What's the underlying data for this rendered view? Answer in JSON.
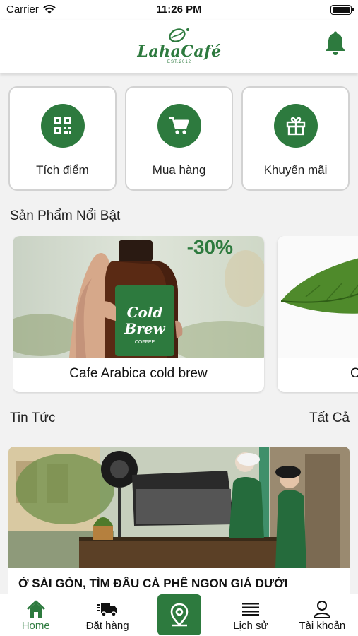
{
  "status_bar": {
    "carrier": "Carrier",
    "time": "11:26 PM"
  },
  "header": {
    "brand": "LahaCafé",
    "est": "EST.2012",
    "bell_icon": "bell-icon"
  },
  "quick_actions": [
    {
      "label": "Tích điểm",
      "icon": "qr-code-icon"
    },
    {
      "label": "Mua hàng",
      "icon": "cart-icon"
    },
    {
      "label": "Khuyến mãi",
      "icon": "gift-icon"
    }
  ],
  "featured": {
    "title": "Sản Phẩm Nổi Bật",
    "products": [
      {
        "name": "Cafe Arabica cold brew",
        "discount": "-30%",
        "bottle_text_1": "Cold",
        "bottle_text_2": "Brew",
        "bottle_text_3": "COFFEE"
      },
      {
        "name": "C"
      }
    ]
  },
  "news": {
    "title": "Tin Tức",
    "see_all": "Tất Cả",
    "articles": [
      {
        "headline": "Ở SÀI GÒN, TÌM ĐÂU CÀ PHÊ NGON GIÁ DƯỚI"
      }
    ]
  },
  "tabbar": {
    "items": [
      {
        "label": "Home",
        "icon": "home-icon",
        "active": true
      },
      {
        "label": "Đặt hàng",
        "icon": "delivery-truck-icon"
      },
      {
        "label": "",
        "icon": "location-pin-icon"
      },
      {
        "label": "Lịch sử",
        "icon": "list-icon"
      },
      {
        "label": "Tài khoản",
        "icon": "user-icon"
      }
    ]
  },
  "colors": {
    "brand_green": "#2d7a3e",
    "background": "#f2f2f2"
  }
}
